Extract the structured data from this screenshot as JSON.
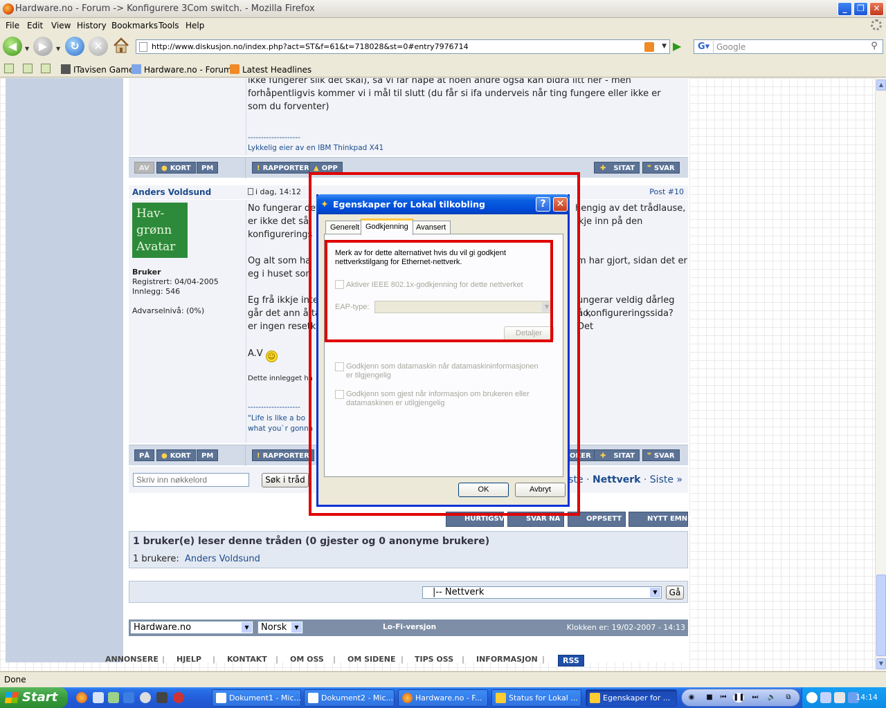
{
  "window": {
    "title": "Hardware.no - Forum -> Konfigurere 3Com switch. - Mozilla Firefox"
  },
  "menu": {
    "file": "File",
    "edit": "Edit",
    "view": "View",
    "history": "History",
    "bookmarks": "Bookmarks",
    "tools": "Tools",
    "help": "Help"
  },
  "nav": {
    "url": "http://www.diskusjon.no/index.php?act=ST&f=61&t=718028&st=0#entry7976714",
    "search_placeholder": "Google"
  },
  "bookmarks_bar": {
    "items": [
      "ITavisen Gamer",
      "Hardware.no - Forum...",
      "Latest Headlines"
    ]
  },
  "post1": {
    "text": "ikke fungerer slik det skal), så vi får håpe at noen andre ogsa kan bidra litt her - men forhåpentligvis kommer vi i mål til slutt (du får si ifa underveis når ting fungere eller ikke er som du forventer)",
    "sig_rule": "--------------------",
    "signature": "Lykkelig eier av en IBM Thinkpad X41",
    "status_btn": "AV",
    "btn_kort": "KORT",
    "btn_pm": "PM",
    "btn_rapporter": "RAPPORTER",
    "btn_opp": "OPP",
    "btn_sitat": "SITAT",
    "btn_svar": "SVAR"
  },
  "post2": {
    "author": "Anders Voldsund",
    "date": "i dag, 14:12",
    "post_no": "Post #10",
    "avatar_text": "Hav-\ngrønn\nAvatar",
    "rank": "Bruker",
    "registered": "Registrert: 04/04-2005",
    "posts": "Innlegg: 546",
    "warn": "Advarselnivå: (0%)",
    "p1a": "No fungerar det",
    "p1b": "hengig av det trådlause,",
    "p1c": "er ikke det så",
    "p1d": "kje inn på den",
    "p1e": "konfigurerings",
    "p2a": "Og alt som ha",
    "p2b": "m har gjort, sidan det er",
    "p2c": "eg i huset son",
    "p3a": "Eg frå ikkje inte",
    "p3b": "ungerar veldig dårleg no,",
    "p3c": "går det ann å ta",
    "p3d": "å konfigureringssida? Det",
    "p3e": "er ingen resetk",
    "closing": "A.V",
    "edited": "Dette innlegget ha",
    "sig_rule": "--------------------",
    "sig1": "\"Life is like a bo",
    "sig2": "what you`r gonna",
    "status_btn": "PÅ",
    "btn_kort": "KORT",
    "btn_pm": "PM",
    "btn_rapporter": "RAPPORTER",
    "btn_blokker": "OKER",
    "btn_sitat": "SITAT",
    "btn_svar": "SVAR"
  },
  "thread_search": {
    "placeholder": "Skriv inn nøkkelord",
    "button": "Søk i tråd"
  },
  "thread_nav": {
    "prev": "rste",
    "sep1": "·",
    "current": "Nettverk",
    "sep2": "·",
    "last": "Siste »"
  },
  "bottom_buttons": {
    "hurtigsvar": "HURTIGSVAR",
    "svar_na": "SVAR NÅ",
    "oppsett": "OPPSETT",
    "nytt_emne": "NYTT EMNE"
  },
  "readers": {
    "heading": "1 bruker(e) leser denne tråden (0 gjester og 0 anonyme brukere)",
    "label": "1 brukere:",
    "user": "Anders Voldsund"
  },
  "forum_jump": {
    "selected": "|-- Nettverk",
    "button": "Gå"
  },
  "footer": {
    "site_select": "Hardware.no",
    "lang_select": "Norsk",
    "lofi": "Lo-Fi-versjon",
    "clock": "Klokken er: 19/02-2007 - 14:13"
  },
  "footer_links": [
    "ANNONSERE",
    "HJELP",
    "KONTAKT",
    "OM OSS",
    "OM SIDENE",
    "TIPS OSS",
    "INFORMASJON"
  ],
  "footer_rss": "RSS",
  "dialog": {
    "title": "Egenskaper for Lokal tilkobling",
    "help": "?",
    "tabs": [
      "Generelt",
      "Godkjenning",
      "Avansert"
    ],
    "intro": "Merk av for dette alternativet hvis du vil gi godkjent nettverkstilgang for Ethernet-nettverk.",
    "chk_ieee": "Aktiver IEEE 802.1x-godkjenning for dette nettverket",
    "eap_label": "EAP-type:",
    "details_btn": "Detaljer",
    "chk_machine": "Godkjenn som datamaskin når datamaskininformasjonen er tilgjengelig",
    "chk_guest": "Godkjenn som gjest når informasjon om brukeren eller datamaskinen er utilgjengelig",
    "ok": "OK",
    "cancel": "Avbryt"
  },
  "statusbar": {
    "text": "Done"
  },
  "taskbar": {
    "start": "Start",
    "tasks": [
      "Dokument1 - Mic...",
      "Dokument2 - Mic...",
      "Hardware.no - F...",
      "Status for Lokal ...",
      "Egenskaper for ..."
    ],
    "clock": "14:14"
  },
  "colors": {
    "accent_red": "#e00000",
    "forum_blue": "#5c7396",
    "xp_blue": "#0a5fe2"
  }
}
